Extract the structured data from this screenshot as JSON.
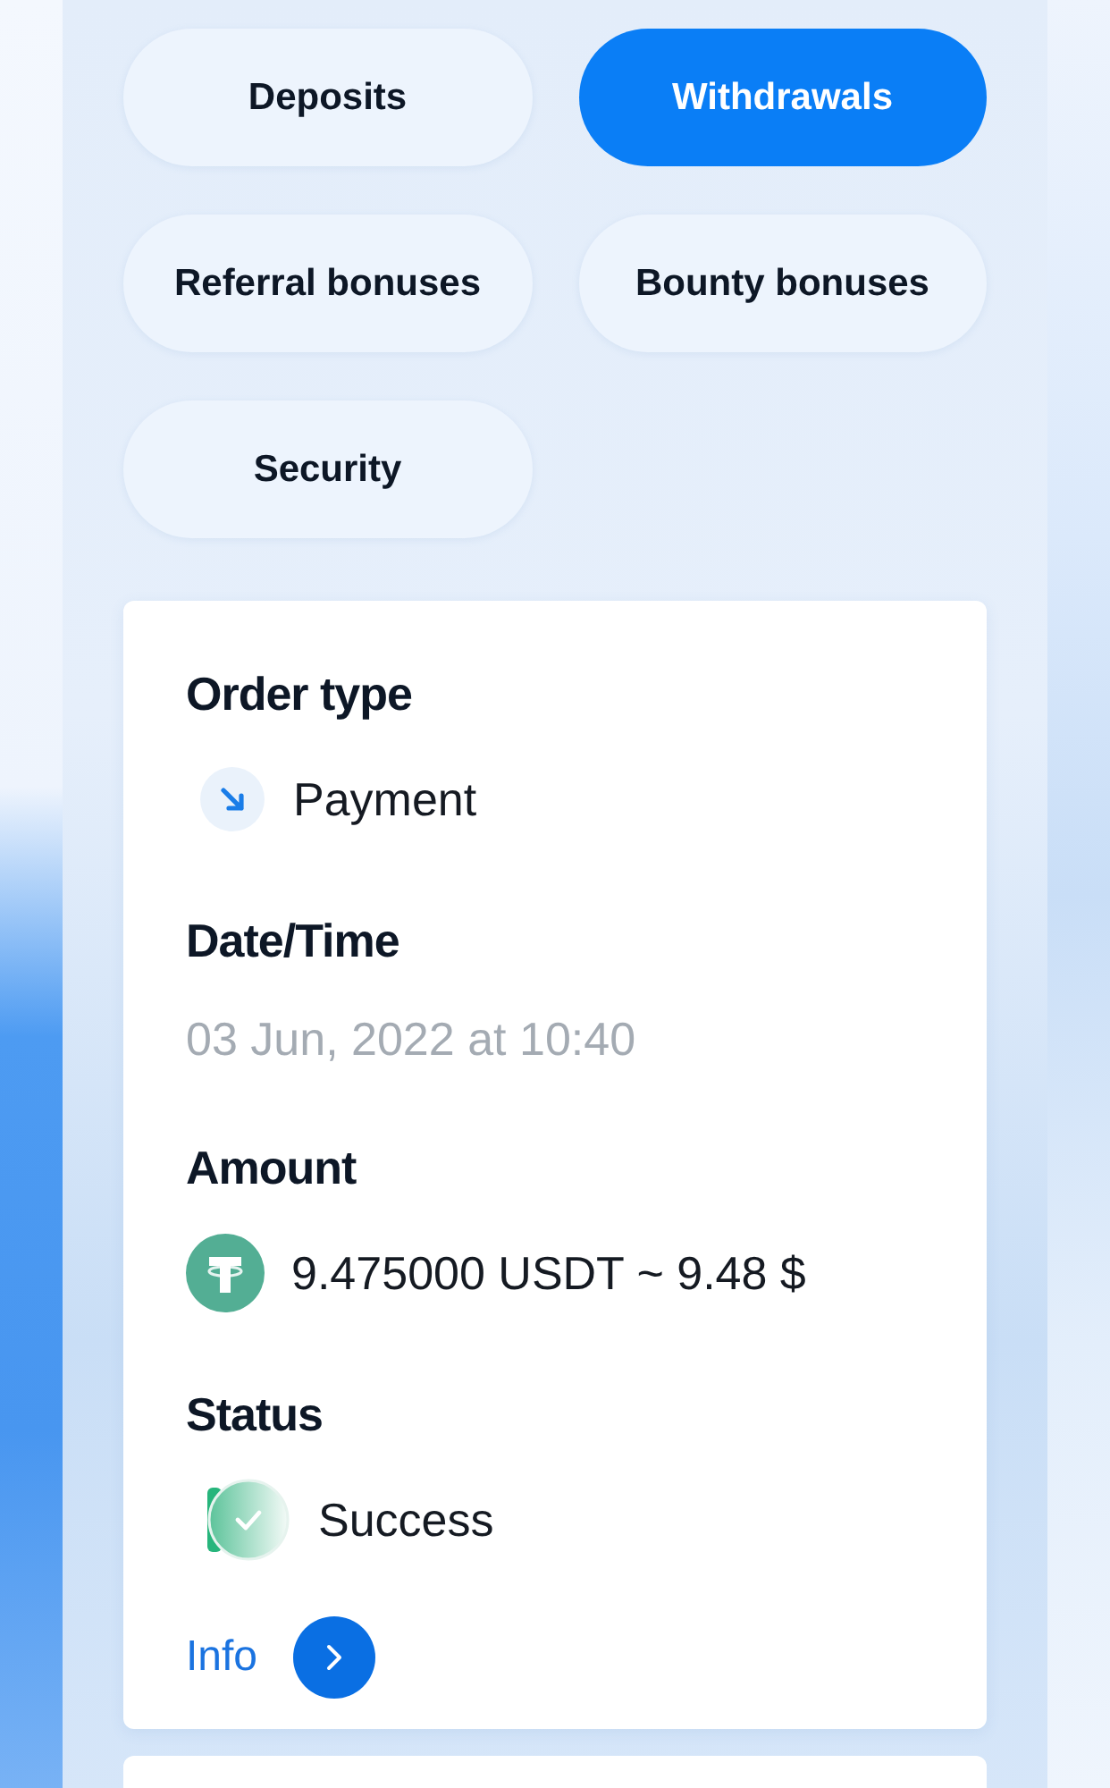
{
  "tabs": [
    {
      "label": "Deposits",
      "selected": false
    },
    {
      "label": "Withdrawals",
      "selected": true
    },
    {
      "label": "Referral bonuses",
      "selected": false
    },
    {
      "label": "Bounty bonuses",
      "selected": false
    },
    {
      "label": "Security",
      "selected": false
    }
  ],
  "order": {
    "fields": [
      {
        "kind": "type",
        "label": "Order type",
        "value": "Payment"
      },
      {
        "kind": "date",
        "label": "Date/Time",
        "value": "03 Jun, 2022 at 10:40"
      },
      {
        "kind": "amount",
        "label": "Amount",
        "value": "9.475000 USDT ~ 9.48 $"
      },
      {
        "kind": "status",
        "label": "Status",
        "value": "Success"
      }
    ],
    "info": {
      "label": "Info"
    }
  }
}
